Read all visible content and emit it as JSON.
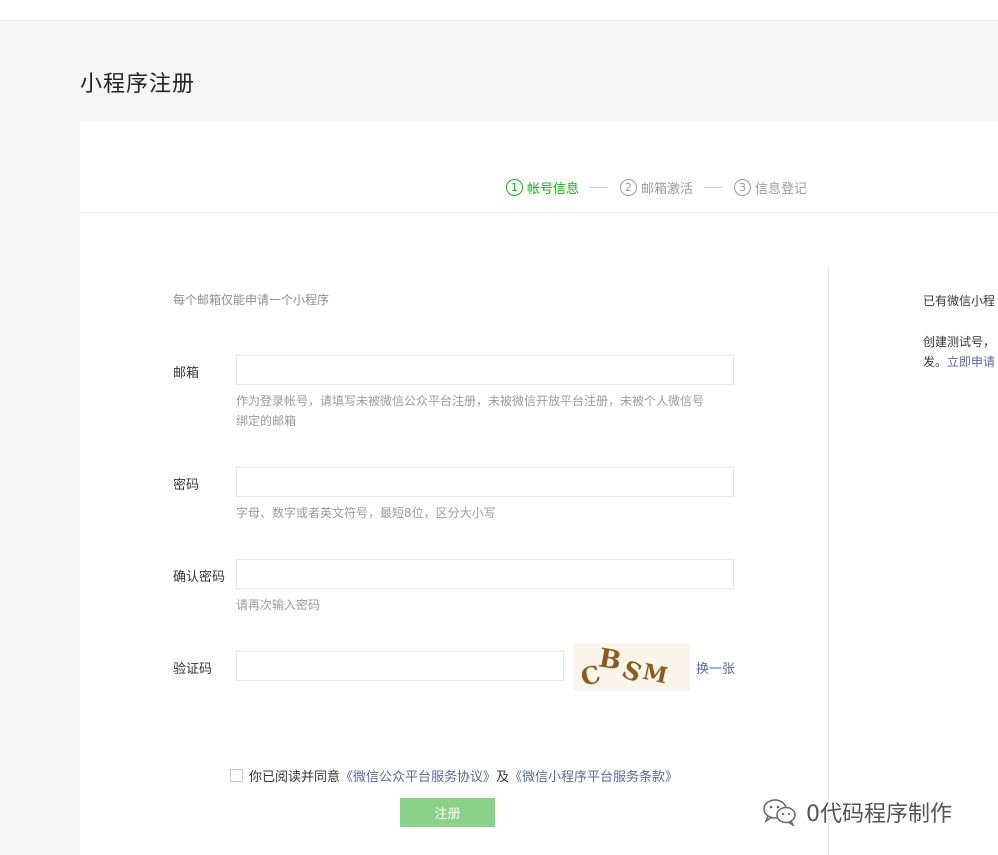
{
  "page": {
    "title": "小程序注册"
  },
  "steps": [
    {
      "num": "1",
      "label": "帐号信息",
      "active": true
    },
    {
      "num": "2",
      "label": "邮箱激活",
      "active": false
    },
    {
      "num": "3",
      "label": "信息登记",
      "active": false
    }
  ],
  "form": {
    "tip": "每个邮箱仅能申请一个小程序",
    "email": {
      "label": "邮箱",
      "value": "",
      "hint1": "作为登录帐号，请填写未被微信公众平台注册，未被微信开放平台注册，未被个人微信号",
      "hint2": "绑定的邮箱"
    },
    "password": {
      "label": "密码",
      "value": "",
      "hint": "字母、数字或者英文符号，最短8位，区分大小写"
    },
    "confirm": {
      "label": "确认密码",
      "value": "",
      "hint": "请再次输入密码"
    },
    "captcha": {
      "label": "验证码",
      "value": "",
      "image_chars": [
        "C",
        "B",
        "S",
        "M"
      ],
      "refresh": "换一张"
    },
    "agreement": {
      "prefix": "你已阅读并同意",
      "link1": "《微信公众平台服务协议》",
      "middle": "及",
      "link2": "《微信小程序平台服务条款》"
    },
    "submit": "注册"
  },
  "side": {
    "line1": "已有微信小程",
    "line2": "创建测试号，",
    "line3_prefix": "发。",
    "line3_link": "立即申请"
  },
  "watermark": {
    "text": "0代码程序制作",
    "icon": "wechat-icon"
  },
  "colors": {
    "accent": "#1aad19",
    "link": "#576b95",
    "button": "#8ad28a"
  }
}
